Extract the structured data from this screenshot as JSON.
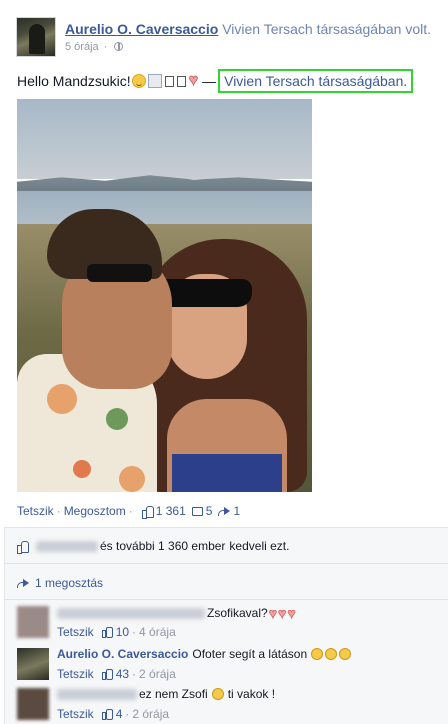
{
  "post": {
    "author": "Aurelio O. Caversaccio",
    "with_text": "Vivien Tersach társaságában volt.",
    "time": "5 órája",
    "text": "Hello Mandzsukic!",
    "tagged": "Vivien Tersach társaságában."
  },
  "actions": {
    "like": "Tetszik",
    "share": "Megosztom",
    "like_count": "1 361",
    "comment_count": "5",
    "share_count": "1"
  },
  "likes_summary": {
    "text": "és további 1 360 ember",
    "suffix": "kedveli ezt."
  },
  "shares_summary": {
    "text": "1 megosztás"
  },
  "comments": [
    {
      "text": "Zsofikaval?",
      "like": "Tetszik",
      "likes": "10",
      "time": "4 órája"
    },
    {
      "author": "Aurelio O. Caversaccio",
      "text": "Ofoter segít a látáson",
      "like": "Tetszik",
      "likes": "43",
      "time": "2 órája"
    },
    {
      "text": "ez nem Zsofi",
      "text2": "ti vakok !",
      "like": "Tetszik",
      "likes": "4",
      "time": "2 órája"
    }
  ],
  "colors": {
    "link": "#3b5998",
    "highlight_box": "#30d530"
  }
}
